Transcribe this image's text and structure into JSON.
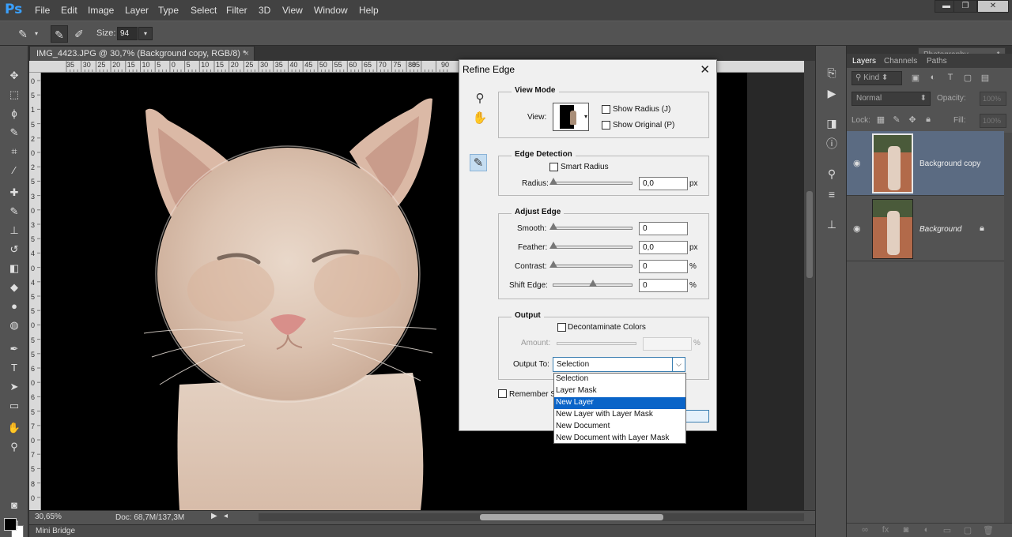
{
  "app": {
    "logo": "Ps"
  },
  "menu": [
    "File",
    "Edit",
    "Image",
    "Layer",
    "Type",
    "Select",
    "Filter",
    "3D",
    "View",
    "Window",
    "Help"
  ],
  "window_controls": {
    "minimize": "▬",
    "restore": "❐",
    "close": "✕"
  },
  "options_bar": {
    "size_label": "Size:",
    "size_value": "94",
    "workspace": "Photography"
  },
  "document": {
    "tab_title": "IMG_4423.JPG @ 30,7% (Background copy, RGB/8) *",
    "tab_close": "×",
    "ruler_h_labels": [
      "35",
      "30",
      "25",
      "20",
      "15",
      "10",
      "5",
      "0",
      "5",
      "10",
      "15",
      "20",
      "25",
      "30",
      "35",
      "40",
      "45",
      "50",
      "55",
      "60",
      "65",
      "70",
      "75",
      "80",
      "85",
      "90"
    ],
    "ruler_v_labels": [
      "0",
      "5",
      "1",
      "5",
      "2",
      "0",
      "2",
      "5",
      "3",
      "0",
      "3",
      "5",
      "4",
      "0",
      "4",
      "5",
      "5",
      "0",
      "5",
      "5",
      "6",
      "0",
      "6",
      "5",
      "7",
      "0",
      "7",
      "5",
      "8",
      "0"
    ]
  },
  "status": {
    "zoom": "30,65%",
    "doc_size": "Doc: 68,7M/137,3M",
    "play": "▶",
    "scroll_arrow": "◂"
  },
  "mini_bridge": "Mini Bridge",
  "refine_edge": {
    "title": "Refine Edge",
    "close": "✕",
    "view_mode": {
      "title": "View Mode",
      "view_label": "View:",
      "show_radius": "Show Radius (J)",
      "show_original": "Show Original (P)"
    },
    "edge_detection": {
      "title": "Edge Detection",
      "smart_radius": "Smart Radius",
      "radius_label": "Radius:",
      "radius_value": "0,0",
      "radius_unit": "px"
    },
    "adjust_edge": {
      "title": "Adjust Edge",
      "smooth_label": "Smooth:",
      "smooth_value": "0",
      "feather_label": "Feather:",
      "feather_value": "0,0",
      "feather_unit": "px",
      "contrast_label": "Contrast:",
      "contrast_value": "0",
      "contrast_unit": "%",
      "shift_label": "Shift Edge:",
      "shift_value": "0",
      "shift_unit": "%"
    },
    "output": {
      "title": "Output",
      "decontaminate": "Decontaminate Colors",
      "amount_label": "Amount:",
      "amount_unit": "%",
      "output_to_label": "Output To:",
      "output_to_value": "Selection",
      "options": [
        "Selection",
        "Layer Mask",
        "New Layer",
        "New Layer with Layer Mask",
        "New Document",
        "New Document with Layer Mask"
      ],
      "highlighted_option": "New Layer"
    },
    "remember": "Remember Se"
  },
  "layers_panel": {
    "tabs": [
      "Layers",
      "Channels",
      "Paths"
    ],
    "kind": "Kind",
    "blend_mode": "Normal",
    "opacity_label": "Opacity:",
    "opacity_value": "100%",
    "lock_label": "Lock:",
    "fill_label": "Fill:",
    "fill_value": "100%",
    "layers": [
      {
        "name": "Background copy",
        "selected": true
      },
      {
        "name": "Background",
        "selected": false,
        "locked": true
      }
    ]
  },
  "colors": {
    "accent": "#0a64c8",
    "selected_layer": "#5b6b82",
    "ps_blue": "#3aa0ff"
  }
}
